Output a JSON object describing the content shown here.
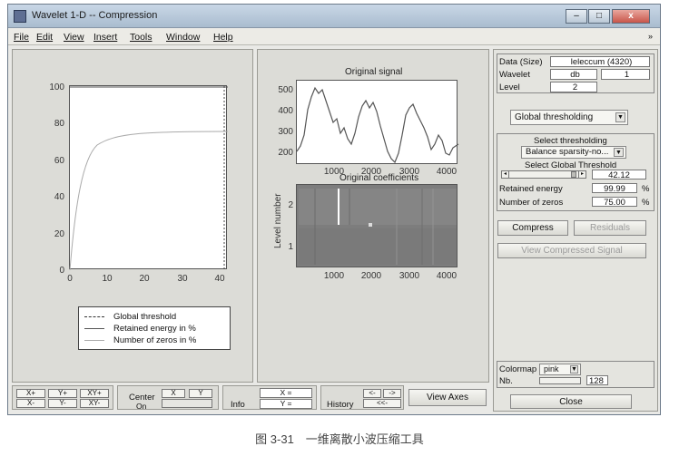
{
  "window": {
    "title": "Wavelet 1-D  --  Compression"
  },
  "titlebar_buttons": {
    "minimize": "–",
    "maximize": "□",
    "close": "x"
  },
  "menu": {
    "items": [
      "File",
      "Edit",
      "View",
      "Insert",
      "Tools",
      "Window",
      "Help"
    ],
    "overflow": "»"
  },
  "left_plot": {
    "yticks": [
      "100",
      "80",
      "60",
      "40",
      "20",
      "0"
    ],
    "xticks": [
      "0",
      "10",
      "20",
      "30",
      "40"
    ],
    "legend": [
      "Global threshold",
      "Retained energy in %",
      "Number of zeros in %"
    ]
  },
  "original_signal": {
    "title": "Original signal",
    "yticks": [
      "500",
      "400",
      "300",
      "200"
    ],
    "xticks": [
      "1000",
      "2000",
      "3000",
      "4000"
    ]
  },
  "coefficients": {
    "title": "Original coefficients",
    "ylabel": "Level number",
    "yticks": [
      "2",
      "1"
    ],
    "xticks": [
      "1000",
      "2000",
      "3000",
      "4000"
    ]
  },
  "data_panel": {
    "data_label": "Data  (Size)",
    "data_value": "leleccum  (4320)",
    "wavelet_label": "Wavelet",
    "wavelet_family": "db",
    "wavelet_order": "1",
    "level_label": "Level",
    "level_value": "2"
  },
  "thresholding": {
    "method": "Global thresholding",
    "select_label": "Select thresholding",
    "select_value": "Balance sparsity-no...",
    "global_label": "Select Global Threshold",
    "threshold_value": "42.12",
    "energy_label": "Retained energy",
    "energy_value": "99.99",
    "energy_unit": "%",
    "zeros_label": "Number of zeros",
    "zeros_value": "75.00",
    "zeros_unit": "%"
  },
  "actions": {
    "compress": "Compress",
    "residuals": "Residuals",
    "view_compressed": "View Compressed Signal",
    "close": "Close"
  },
  "colormap": {
    "label": "Colormap",
    "value": "pink",
    "nb_label": "Nb.",
    "nb_value": "128"
  },
  "bottom": {
    "xplus": "X+",
    "yplus": "Y+",
    "xyplus": "XY+",
    "xminus": "X-",
    "yminus": "Y-",
    "xyminus": "XY-",
    "center_label": "Center",
    "center_x": "X",
    "center_y": "Y",
    "center_on": "On",
    "info_label": "Info",
    "info_x": "X =",
    "info_y": "Y =",
    "history_label": "History",
    "hist_back": "<-",
    "hist_fwd": "->",
    "hist_first": "<<-",
    "view_axes": "View Axes"
  },
  "caption": "图 3-31　一维离散小波压缩工具"
}
